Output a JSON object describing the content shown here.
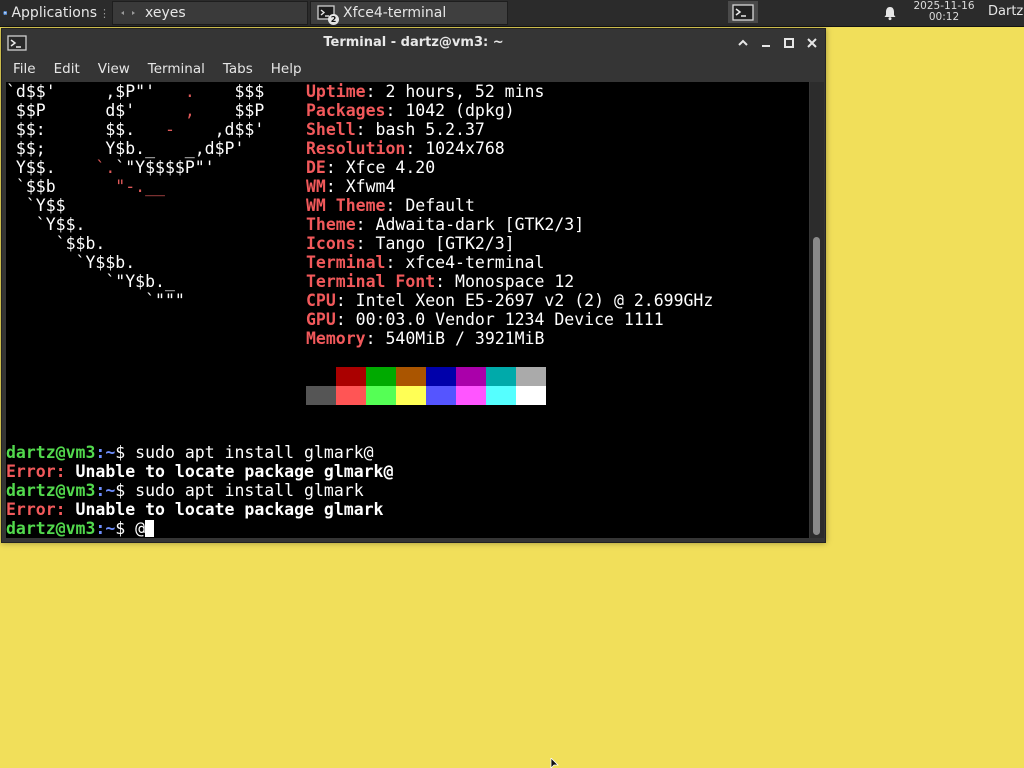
{
  "panel": {
    "app_menu_label": "Applications",
    "tasks": [
      {
        "label": "xeyes"
      },
      {
        "label": "Xfce4-terminal",
        "badge": "2"
      }
    ],
    "clock": {
      "date": "2025-11-16",
      "time": "00:12"
    },
    "user": "Dartz"
  },
  "window": {
    "title": "Terminal - dartz@vm3: ~",
    "menu": [
      "File",
      "Edit",
      "View",
      "Terminal",
      "Tabs",
      "Help"
    ]
  },
  "terminal": {
    "ascii_logo": [
      {
        "w": "`d$$'     ,$P\"'   ",
        "r": ".",
        "w2": "    $$$"
      },
      {
        "w": " $$P      d$'     ",
        "r": ",",
        "w2": "    $$P"
      },
      {
        "w": " $$:      $$.   ",
        "r": "-",
        "w2": "    ,d$$'"
      },
      {
        "w": " $$;      Y$b._   _,d$P'",
        "r": "",
        "w2": ""
      },
      {
        "w": " Y$$.    ",
        "r": "`.",
        "w2": "`\"Y$$$$P\"'"
      },
      {
        "w": " `$$b      ",
        "r": "\"-.__",
        "w2": ""
      },
      {
        "w": "  `Y$$",
        "r": "",
        "w2": ""
      },
      {
        "w": "   `Y$$.",
        "r": "",
        "w2": ""
      },
      {
        "w": "     `$$b.",
        "r": "",
        "w2": ""
      },
      {
        "w": "       `Y$$b.",
        "r": "",
        "w2": ""
      },
      {
        "w": "          `\"Y$b._",
        "r": "",
        "w2": ""
      },
      {
        "w": "              `\"\"\"",
        "r": "",
        "w2": ""
      }
    ],
    "sysinfo": [
      {
        "key": "Uptime",
        "value": ": 2 hours, 52 mins"
      },
      {
        "key": "Packages",
        "value": ": 1042 (dpkg)"
      },
      {
        "key": "Shell",
        "value": ": bash 5.2.37"
      },
      {
        "key": "Resolution",
        "value": ": 1024x768"
      },
      {
        "key": "DE",
        "value": ": Xfce 4.20"
      },
      {
        "key": "WM",
        "value": ": Xfwm4"
      },
      {
        "key": "WM Theme",
        "value": ": Default"
      },
      {
        "key": "Theme",
        "value": ": Adwaita-dark [GTK2/3]"
      },
      {
        "key": "Icons",
        "value": ": Tango [GTK2/3]"
      },
      {
        "key": "Terminal",
        "value": ": xfce4-terminal"
      },
      {
        "key": "Terminal Font",
        "value": ": Monospace 12"
      },
      {
        "key": "CPU",
        "value": ": Intel Xeon E5-2697 v2 (2) @ 2.699GHz"
      },
      {
        "key": "GPU",
        "value": ": 00:03.0 Vendor 1234 Device 1111"
      },
      {
        "key": "Memory",
        "value": ": 540MiB / 3921MiB"
      }
    ],
    "palette_top": [
      "#000000",
      "#aa0000",
      "#00aa00",
      "#aa5500",
      "#0000aa",
      "#aa00aa",
      "#00aaaa",
      "#aaaaaa"
    ],
    "palette_bottom": [
      "#555555",
      "#ff5555",
      "#55ff55",
      "#ffff55",
      "#5555ff",
      "#ff55ff",
      "#55ffff",
      "#ffffff"
    ],
    "prompt": "dartz@vm3",
    "path": ":~",
    "dollar": "$",
    "lines": [
      {
        "type": "cmd",
        "text": " sudo apt install glmark@"
      },
      {
        "type": "err",
        "label": "Error:",
        "text": " Unable to locate package glmark@"
      },
      {
        "type": "cmd",
        "text": " sudo apt install glmark"
      },
      {
        "type": "err",
        "label": "Error:",
        "text": " Unable to locate package glmark"
      },
      {
        "type": "cmd",
        "text": " @"
      }
    ]
  }
}
